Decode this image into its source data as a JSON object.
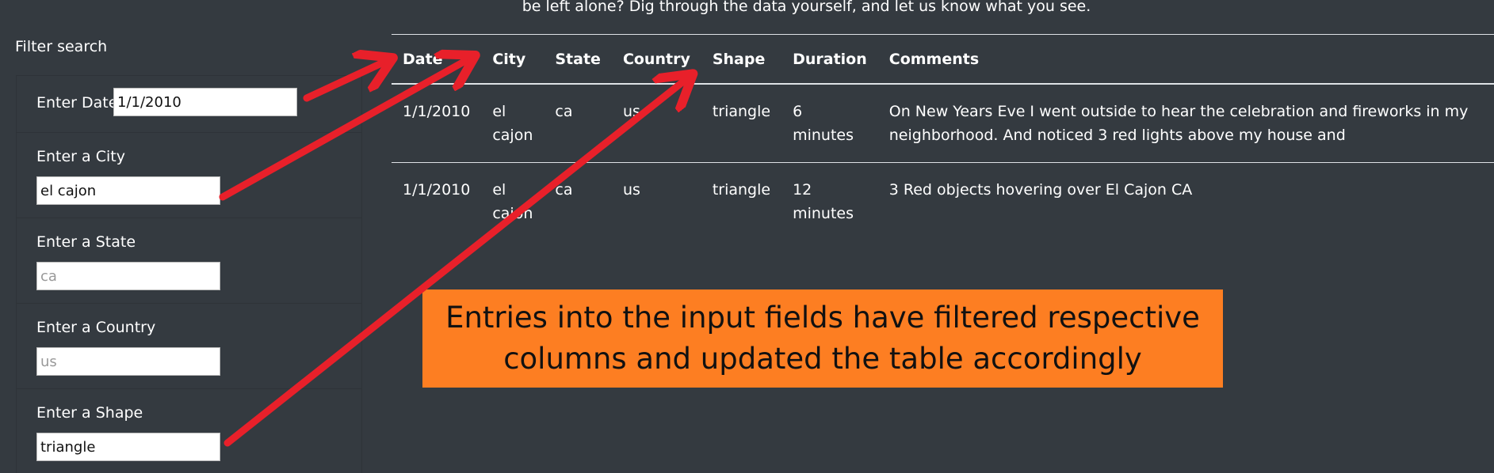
{
  "intro": {
    "text": "be left alone? Dig through the data yourself, and let us know what you see."
  },
  "filter": {
    "title": "Filter search",
    "fields": [
      {
        "label": "Enter Date",
        "value": "1/1/2010",
        "placeholder": ""
      },
      {
        "label": "Enter a City",
        "value": "el cajon",
        "placeholder": ""
      },
      {
        "label": "Enter a State",
        "value": "",
        "placeholder": "ca"
      },
      {
        "label": "Enter a Country",
        "value": "",
        "placeholder": "us"
      },
      {
        "label": "Enter a Shape",
        "value": "triangle",
        "placeholder": ""
      }
    ]
  },
  "table": {
    "headers": [
      "Date",
      "City",
      "State",
      "Country",
      "Shape",
      "Duration",
      "Comments"
    ],
    "rows": [
      [
        "1/1/2010",
        "el cajon",
        "ca",
        "us",
        "triangle",
        "6 minutes",
        "On New Years Eve I went outside to hear the celebration and fireworks in my neighborhood. And noticed 3 red lights above my house and"
      ],
      [
        "1/1/2010",
        "el cajon",
        "ca",
        "us",
        "triangle",
        "12 minutes",
        "3 Red objects hovering over El Cajon CA"
      ]
    ]
  },
  "callout": {
    "text": "Entries into the input fields have filtered respective columns and updated the table accordingly"
  },
  "colors": {
    "background": "#343a40",
    "callout": "#fd7e22",
    "arrow": "#e8202a"
  }
}
